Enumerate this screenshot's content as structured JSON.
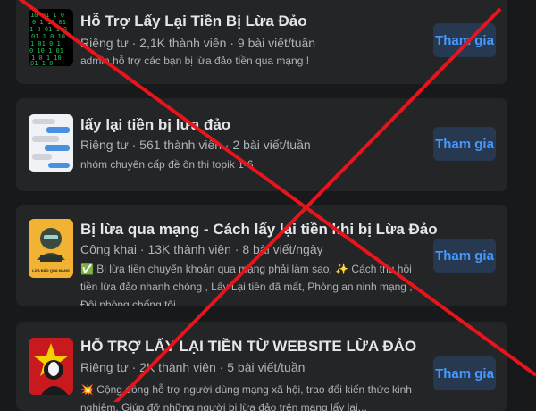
{
  "groups": [
    {
      "title": "Hỗ Trợ Lấy Lại Tiền Bị Lừa Đảo",
      "meta": "Riêng tư · 2,1K thành viên · 9 bài viết/tuần",
      "description": "admin hỗ trợ các bạn bị lừa đảo tiền qua mạng !",
      "join_label": "Tham gia"
    },
    {
      "title": "lấy lại tiền bị lừa đảo",
      "meta": "Riêng tư · 561 thành viên · 2 bài viết/tuần",
      "description": "nhóm chuyên cấp đề ôn thi topik 1-6",
      "join_label": "Tham gia"
    },
    {
      "title": "Bị lừa qua mạng - Cách lấy lại tiền khi bị Lừa Đảo",
      "meta": "Công khai · 13K thành viên · 8 bài viết/ngày",
      "description": "✅ Bị lừa tiền chuyển khoản qua mạng phải làm sao, ✨ Cách thu hồi tiền lừa đảo nhanh chóng , Lấy Lại tiền đã mất, Phòng an ninh mạng , Đội phòng chống tội...",
      "thumb_caption": "LỪA ĐẢO QUA MẠNG",
      "join_label": "Tham gia"
    },
    {
      "title": "HỖ TRỢ LẤY LẠI TIỀN TỪ WEBSITE LỪA ĐẢO",
      "meta": "Riêng tư · 2K thành viên · 5 bài viết/tuần",
      "description": "💥 Cộng đồng hỗ trợ người dùng mạng xã hội, trao đổi kiến thức kinh nghiệm. Giúp đỡ những người bị lừa đảo trên mạng lấy lại...",
      "join_label": "Tham gia"
    }
  ],
  "overlay": {
    "cross_color": "#e8141b"
  },
  "colors": {
    "background": "#18191a",
    "card": "#242526",
    "button_bg": "#263951",
    "button_text": "#4599ff"
  }
}
